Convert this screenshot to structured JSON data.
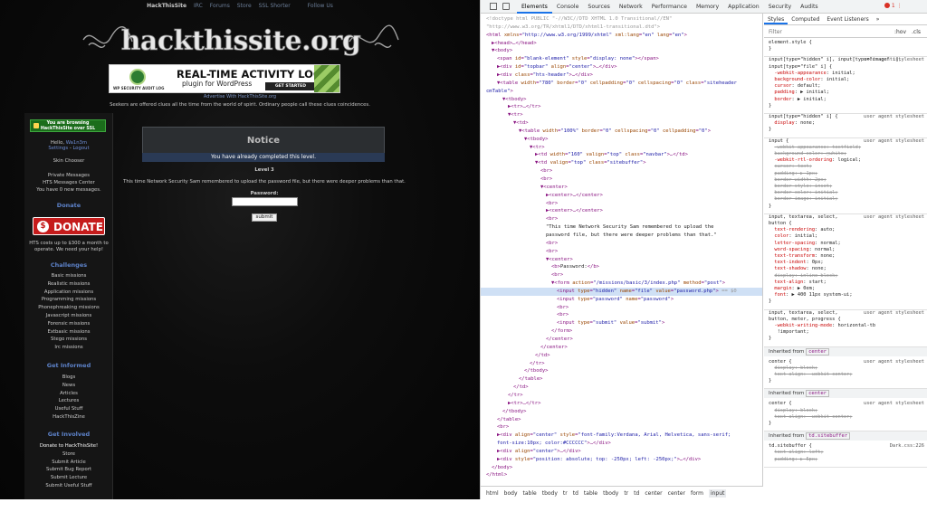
{
  "site": {
    "topnav": [
      "HackThisSite",
      "IRC",
      "Forums",
      "Store",
      "SSL Shorter",
      "Follow Us"
    ],
    "logo_text": "hackthissite.org",
    "ad": {
      "title": "REAL-TIME ACTIVITY LOG",
      "subtitle": "plugin for WordPress",
      "cta": "GET STARTED",
      "brand": "WP SECURITY AUDIT LOG"
    },
    "advertise": "Advertise With HackThisSite.org",
    "tagline": "Seekers are offered clues all the time from the world of spirit. Ordinary people call these clues coincidences.",
    "sidebar": {
      "ssl": [
        "You are browsing",
        "HackThisSite over SSL"
      ],
      "hello_prefix": "Hello, ",
      "username": "Wa1n3m",
      "settings": "Settings",
      "separator": " - ",
      "logout": "Logout",
      "skin_chooser": "Skin Chooser",
      "private_messages": "Private Messages",
      "messages_center": "HTS Messages Center",
      "new_messages": "You have 0 new messages.",
      "donate_head": "Donate",
      "donate_btn": "DONATE",
      "cost_note": [
        "HTS costs up to $300 a month to",
        "operate. We need your help!"
      ],
      "challenges_head": "Challenges",
      "challenges": [
        "Basic missions",
        "Realistic missions",
        "Application missions",
        "Programming missions",
        "Phonephreaking missions",
        "Javascript missions",
        "Forensic missions",
        "Extbasic missions",
        "Stego missions",
        "Irc missions"
      ],
      "informed_head": "Get Informed",
      "informed": [
        "Blogs",
        "News",
        "Articles",
        "Lectures",
        "Useful Stuff",
        "HackThisZine"
      ],
      "involved_head": "Get Involved",
      "involved": [
        "Donate to HackThisSite!",
        "Store",
        "Submit Article",
        "Submit Bug Report",
        "Submit Lecture",
        "Submit Useful Stuff"
      ]
    },
    "main": {
      "notice_title": "Notice",
      "notice_msg": "You have already completed this level.",
      "level": "Level 3",
      "story": "This time Network Security Sam remembered to upload the password file, but there were deeper problems than that.",
      "password_label": "Password:",
      "password_value": "",
      "submit": "submit"
    }
  },
  "devtools": {
    "tabs": [
      "Elements",
      "Console",
      "Sources",
      "Network",
      "Performance",
      "Memory",
      "Application",
      "Security",
      "Audits"
    ],
    "active_tab": "Elements",
    "error_count": "1",
    "dom_lines": [
      {
        "indent": 0,
        "html": "<span class='cm'>&lt;!doctype html PUBLIC \"-//W3C//DTD XHTML 1.0 Transitional//EN\"</span>"
      },
      {
        "indent": 0,
        "html": "<span class='cm'>\"http://www.w3.org/TR/xhtml1/DTD/xhtml1-transitional.dtd\"&gt;</span>"
      },
      {
        "indent": 0,
        "html": "&lt;html <span class='at'>xmlns</span>=<span class='av'>\"http://www.w3.org/1999/xhtml\"</span> <span class='at'>xml:lang</span>=<span class='av'>\"en\"</span> <span class='at'>lang</span>=<span class='av'>\"en\"</span>&gt;"
      },
      {
        "indent": 1,
        "html": "▶&lt;head&gt;…&lt;/head&gt;"
      },
      {
        "indent": 1,
        "html": "▼&lt;body&gt;"
      },
      {
        "indent": 2,
        "html": "&lt;span <span class='at'>id</span>=<span class='av'>\"blank-element\"</span> <span class='at'>style</span>=<span class='av'>\"display: none\"</span>&gt;&lt;/span&gt;"
      },
      {
        "indent": 2,
        "html": "▶&lt;div <span class='at'>id</span>=<span class='av'>\"topbar\"</span> <span class='at'>align</span>=<span class='av'>\"center\"</span>&gt;…&lt;/div&gt;"
      },
      {
        "indent": 2,
        "html": "▶&lt;div <span class='at'>class</span>=<span class='av'>\"hts-header\"</span>&gt;…&lt;/div&gt;"
      },
      {
        "indent": 2,
        "html": "▼&lt;table <span class='at'>width</span>=<span class='av'>\"780\"</span> <span class='at'>border</span>=<span class='av'>\"0\"</span> <span class='at'>cellpadding</span>=<span class='av'>\"0\"</span> <span class='at'>cellspacing</span>=<span class='av'>\"0\"</span> <span class='at'>class</span>=<span class='av'>\"siteheader</span>"
      },
      {
        "indent": 0,
        "html": "<span class='av'>cmTable\"</span>&gt;"
      },
      {
        "indent": 3,
        "html": "▼&lt;tbody&gt;"
      },
      {
        "indent": 4,
        "html": "▶&lt;tr&gt;…&lt;/tr&gt;"
      },
      {
        "indent": 4,
        "html": "▼&lt;tr&gt;"
      },
      {
        "indent": 5,
        "html": "▼&lt;td&gt;"
      },
      {
        "indent": 6,
        "html": "▼&lt;table <span class='at'>width</span>=<span class='av'>\"100%\"</span> <span class='at'>border</span>=<span class='av'>\"0\"</span> <span class='at'>cellspacing</span>=<span class='av'>\"0\"</span> <span class='at'>cellpadding</span>=<span class='av'>\"0\"</span>&gt;"
      },
      {
        "indent": 7,
        "html": "▼&lt;tbody&gt;"
      },
      {
        "indent": 8,
        "html": "▼&lt;tr&gt;"
      },
      {
        "indent": 9,
        "html": "▶&lt;td <span class='at'>width</span>=<span class='av'>\"160\"</span> <span class='at'>valign</span>=<span class='av'>\"top\"</span> <span class='at'>class</span>=<span class='av'>\"navbar\"</span>&gt;…&lt;/td&gt;"
      },
      {
        "indent": 9,
        "html": "▼&lt;td <span class='at'>valign</span>=<span class='av'>\"top\"</span> <span class='at'>class</span>=<span class='av'>\"sitebuffer\"</span>&gt;"
      },
      {
        "indent": 10,
        "html": "&lt;br&gt;"
      },
      {
        "indent": 10,
        "html": "&lt;br&gt;"
      },
      {
        "indent": 10,
        "html": "▼&lt;center&gt;"
      },
      {
        "indent": 11,
        "html": "▶&lt;center&gt;…&lt;/center&gt;"
      },
      {
        "indent": 11,
        "html": "&lt;br&gt;"
      },
      {
        "indent": 11,
        "html": "▶&lt;center&gt;…&lt;/center&gt;"
      },
      {
        "indent": 11,
        "html": "&lt;br&gt;"
      },
      {
        "indent": 11,
        "html": "<span class='tx'>\"This time Network Security Sam remembered to upload the</span>"
      },
      {
        "indent": 11,
        "html": "<span class='tx'>password file, but there were deeper problems than that.\"</span>"
      },
      {
        "indent": 11,
        "html": "&lt;br&gt;"
      },
      {
        "indent": 11,
        "html": "&lt;br&gt;"
      },
      {
        "indent": 11,
        "html": "▼&lt;center&gt;"
      },
      {
        "indent": 12,
        "html": "&lt;b&gt;<span class='tx'>Password:</span>&lt;/b&gt;"
      },
      {
        "indent": 12,
        "html": "&lt;br&gt;"
      },
      {
        "indent": 12,
        "html": "▼&lt;form <span class='at'>action</span>=<span class='av'>\"/missions/basic/3/index.php\"</span> <span class='at'>method</span>=<span class='av'>\"post\"</span>&gt;"
      },
      {
        "indent": 13,
        "sel": true,
        "html": "&lt;input <span class='at'>type</span>=<span class='av'>\"hidden\"</span> <span class='at'>name</span>=<span class='av'>\"file\"</span> <span class='at'>value</span>=<span class='av'>\"password.php\"</span>&gt; <span class='cm'>== $0</span>"
      },
      {
        "indent": 13,
        "html": "&lt;input <span class='at'>type</span>=<span class='av'>\"password\"</span> <span class='at'>name</span>=<span class='av'>\"password\"</span>&gt;"
      },
      {
        "indent": 13,
        "html": "&lt;br&gt;"
      },
      {
        "indent": 13,
        "html": "&lt;br&gt;"
      },
      {
        "indent": 13,
        "html": "&lt;input <span class='at'>type</span>=<span class='av'>\"submit\"</span> <span class='at'>value</span>=<span class='av'>\"submit\"</span>&gt;"
      },
      {
        "indent": 12,
        "html": "&lt;/form&gt;"
      },
      {
        "indent": 11,
        "html": "&lt;/center&gt;"
      },
      {
        "indent": 10,
        "html": "&lt;/center&gt;"
      },
      {
        "indent": 9,
        "html": "&lt;/td&gt;"
      },
      {
        "indent": 8,
        "html": "&lt;/tr&gt;"
      },
      {
        "indent": 7,
        "html": "&lt;/tbody&gt;"
      },
      {
        "indent": 6,
        "html": "&lt;/table&gt;"
      },
      {
        "indent": 5,
        "html": "&lt;/td&gt;"
      },
      {
        "indent": 4,
        "html": "&lt;/tr&gt;"
      },
      {
        "indent": 4,
        "html": "▶&lt;tr&gt;…&lt;/tr&gt;"
      },
      {
        "indent": 3,
        "html": "&lt;/tbody&gt;"
      },
      {
        "indent": 2,
        "html": "&lt;/table&gt;"
      },
      {
        "indent": 2,
        "html": "&lt;br&gt;"
      },
      {
        "indent": 2,
        "html": "▶&lt;div <span class='at'>align</span>=<span class='av'>\"center\"</span> <span class='at'>style</span>=<span class='av'>\"font-family:Verdana, Arial, Helvetica, sans-serif;</span>"
      },
      {
        "indent": 2,
        "html": "<span class='av'>font-size:10px; color:#CCCCCC\"</span>&gt;…&lt;/div&gt;"
      },
      {
        "indent": 2,
        "html": "▶&lt;div <span class='at'>align</span>=<span class='av'>\"center\"</span>&gt;…&lt;/div&gt;"
      },
      {
        "indent": 2,
        "html": "▶&lt;div <span class='at'>style</span>=<span class='av'>\"position: absolute; top: -250px; left: -250px;\"</span>&gt;…&lt;/div&gt;"
      },
      {
        "indent": 1,
        "html": "&lt;/body&gt;"
      },
      {
        "indent": 0,
        "html": "&lt;/html&gt;"
      }
    ],
    "breadcrumb": [
      "html",
      "body",
      "table",
      "tbody",
      "tr",
      "td",
      "table",
      "tbody",
      "tr",
      "td",
      "center",
      "center",
      "form",
      "input"
    ],
    "styles": {
      "tabs": [
        "Styles",
        "Computed",
        "Event Listeners",
        "»"
      ],
      "filter_placeholder": "Filter",
      "hov": ":hov",
      "cls": ".cls",
      "rules": [
        {
          "lines": [
            "element.style {",
            "}"
          ]
        },
        {
          "src": "user agent stylesheet",
          "lines": [
            "input[type=\"hidden\" i], input[type=\"image\" i],",
            "input[type=\"file\" i] {",
            "  <span class='pn'>-webkit-appearance</span>: initial;",
            "  <span class='pn'>background-color</span>: initial;",
            "  <span class='pn'>cursor</span>: default;",
            "  <span class='pn'>padding</span>: ▶ initial;",
            "  <span class='pn'>border</span>: ▶ initial;",
            "}"
          ]
        },
        {
          "src": "user agent stylesheet",
          "lines": [
            "input[type=\"hidden\" i] {",
            "  <span class='pn'>display</span>: none;",
            "}"
          ]
        },
        {
          "src": "user agent stylesheet",
          "lines": [
            "input {",
            "  <span class='strike'>-webkit-appearance: textfield;</span>",
            "  <span class='strike'>background-color: ▢white;</span>",
            "  <span class='pn'>-webkit-rtl-ordering</span>: logical;",
            "  <span class='strike'>cursor: text;</span>",
            "  <span class='strike'>padding: ▶ 1px;</span>",
            "  <span class='strike'>border-width: 2px;</span>",
            "  <span class='strike'>border-style: inset;</span>",
            "  <span class='strike'>border-color: initial;</span>",
            "  <span class='strike'>border-image: initial;</span>",
            "}"
          ]
        },
        {
          "src": "user agent stylesheet",
          "lines": [
            "input, textarea, select,",
            "button {",
            "  <span class='pn'>text-rendering</span>: auto;",
            "  <span class='pn'>color</span>: initial;",
            "  <span class='pn'>letter-spacing</span>: normal;",
            "  <span class='pn'>word-spacing</span>: normal;",
            "  <span class='pn'>text-transform</span>: none;",
            "  <span class='pn'>text-indent</span>: 0px;",
            "  <span class='pn'>text-shadow</span>: none;",
            "  <span class='strike'>display: inline-block;</span>",
            "  <span class='pn'>text-align</span>: start;",
            "  <span class='pn'>margin</span>: ▶ 0em;",
            "  <span class='pn'>font</span>: ▶ 400 11px system-ui;",
            "}"
          ]
        },
        {
          "src": "user agent stylesheet",
          "lines": [
            "input, textarea, select,",
            "button, meter, progress {",
            "  <span class='pn'>-webkit-writing-mode</span>: horizontal-tb",
            "    !important;",
            "}"
          ]
        }
      ],
      "inherited": [
        {
          "label": "Inherited from ",
          "chip": "center",
          "src": "user agent stylesheet",
          "lines": [
            "center {",
            "  <span class='strike'>display: block;</span>",
            "  <span class='strike'>text-align: -webkit-center;</span>",
            "}"
          ]
        },
        {
          "label": "Inherited from ",
          "chip": "center",
          "src": "user agent stylesheet",
          "lines": [
            "center {",
            "  <span class='strike'>display: block;</span>",
            "  <span class='strike'>text-align: -webkit-center;</span>",
            "}"
          ]
        },
        {
          "label": "Inherited from ",
          "chip": "td.sitebuffer",
          "src": "Dark.css:226",
          "lines": [
            "td.sitebuffer {",
            "  <span class='strike'>text-align: left;</span>",
            "  <span class='strike'>padding: ▶ 5px;</span>"
          ]
        }
      ]
    }
  }
}
